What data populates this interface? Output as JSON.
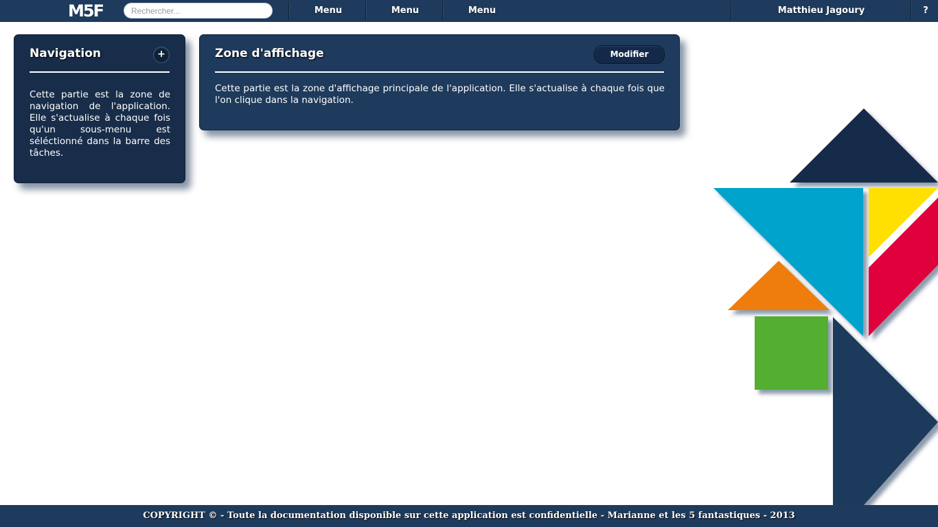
{
  "topbar": {
    "logo": "M5F",
    "search_placeholder": "Rechercher...",
    "menus": [
      "Menu",
      "Menu",
      "Menu"
    ],
    "user_name": "Matthieu Jagoury",
    "help_label": "?"
  },
  "navigation_panel": {
    "title": "Navigation",
    "add_label": "+",
    "text": "Cette partie est la zone de navigation de l'application. Elle s'actualise à chaque fois qu'un sous-menu est séléctionné dans la barre des tâches."
  },
  "main_panel": {
    "title": "Zone d'affichage",
    "button_label": "Modifier",
    "text": "Cette partie est la zone d'affichage principale de l'application. Elle s'actualise à chaque fois que l'on clique dans la navigation."
  },
  "footer": {
    "text": "COPYRIGHT © - Toute la documentation disponible sur cette application est confidentielle - Marianne et les 5 fantastiques - 2013"
  },
  "colors": {
    "brand_navy": "#1e3a5c",
    "dark_navy": "#14294a",
    "tangram_cyan": "#00a3cc",
    "tangram_yellow": "#ffe000",
    "tangram_red": "#e0003a",
    "tangram_orange": "#ee7d10",
    "tangram_green": "#52ae32"
  }
}
